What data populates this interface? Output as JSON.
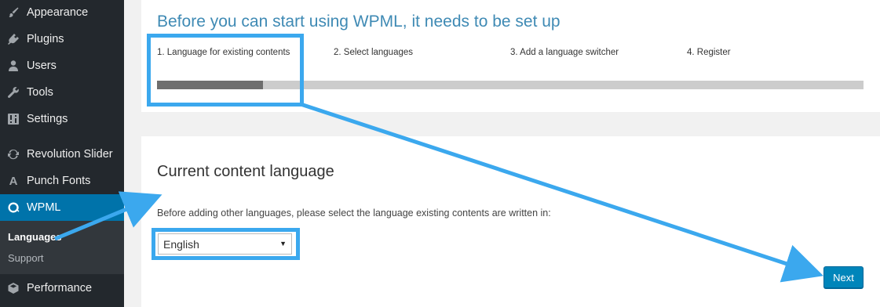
{
  "sidebar": {
    "items": [
      {
        "label": "Appearance",
        "icon": "paintbrush-icon"
      },
      {
        "label": "Plugins",
        "icon": "plugin-icon"
      },
      {
        "label": "Users",
        "icon": "users-icon"
      },
      {
        "label": "Tools",
        "icon": "wrench-icon"
      },
      {
        "label": "Settings",
        "icon": "settings-sliders-icon"
      },
      {
        "label": "Revolution Slider",
        "icon": "refresh-icon"
      },
      {
        "label": "Punch Fonts",
        "icon": "font-a-icon"
      },
      {
        "label": "WPML",
        "icon": "wpml-icon"
      },
      {
        "label": "Performance",
        "icon": "cube-icon"
      }
    ],
    "submenu": [
      "Languages",
      "Support"
    ]
  },
  "wizard": {
    "title": "Before you can start using WPML, it needs to be set up",
    "steps": [
      "1. Language for existing contents",
      "2. Select languages",
      "3. Add a language switcher",
      "4. Register"
    ],
    "progress": 0.15,
    "current_step": 1
  },
  "content_language": {
    "heading": "Current content language",
    "instruction": "Before adding other languages, please select the language existing contents are written in:",
    "selected_language": "English",
    "next_label": "Next"
  },
  "colors": {
    "sidebar_bg": "#23282d",
    "sidebar_current": "#0073aa",
    "title_blue": "#3f8ab4",
    "button_blue": "#0085ba",
    "annotation": "#3ba8ee"
  }
}
